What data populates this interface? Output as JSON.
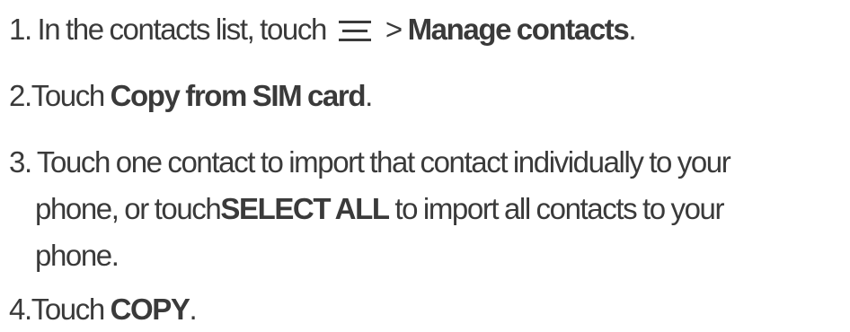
{
  "steps": [
    {
      "number": "1.",
      "text_before_icon": "In the contacts list, touch",
      "icon": "menu-icon",
      "separator": ">",
      "bold": "Manage contacts",
      "end": "."
    },
    {
      "number": "2.",
      "text": "Touch",
      "bold": "Copy from SIM card",
      "end": "."
    },
    {
      "number": "3.",
      "line1": "Touch one contact to import that contact individually to your",
      "line2_prefix": "phone, or touch",
      "bold": "SELECT ALL",
      "line2_suffix": "to import all contacts to your",
      "line3": "phone."
    },
    {
      "number": "4.",
      "text": "Touch",
      "bold": "COPY",
      "end": "."
    }
  ]
}
